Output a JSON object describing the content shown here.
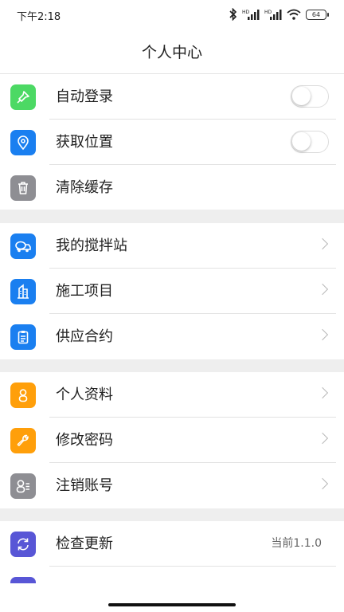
{
  "status_bar": {
    "time": "下午2:18",
    "battery": "64",
    "icons": [
      "bluetooth-icon",
      "hd-signal-icon",
      "hd-signal-icon",
      "wifi-icon",
      "battery-icon"
    ]
  },
  "header": {
    "title": "个人中心"
  },
  "colors": {
    "green": "#4cd964",
    "blue": "#1a7ff0",
    "gray": "#8e8e93",
    "orange": "#ff9f0a",
    "purple": "#5856d6",
    "section_gap": "#eeeeee"
  },
  "settings": [
    {
      "label": "自动登录",
      "icon": "pin-icon",
      "toggle_on": false
    },
    {
      "label": "获取位置",
      "icon": "location-icon",
      "toggle_on": false
    },
    {
      "label": "清除缓存",
      "icon": "trash-icon"
    }
  ],
  "business": [
    {
      "label": "我的搅拌站",
      "icon": "mixer-truck-icon"
    },
    {
      "label": "施工项目",
      "icon": "building-icon"
    },
    {
      "label": "供应合约",
      "icon": "clipboard-icon"
    }
  ],
  "account": [
    {
      "label": "个人资料",
      "icon": "person-icon"
    },
    {
      "label": "修改密码",
      "icon": "wrench-icon"
    },
    {
      "label": "注销账号",
      "icon": "person-cancel-icon"
    }
  ],
  "about": [
    {
      "label": "检查更新",
      "icon": "refresh-icon",
      "value": "当前1.1.0"
    }
  ]
}
